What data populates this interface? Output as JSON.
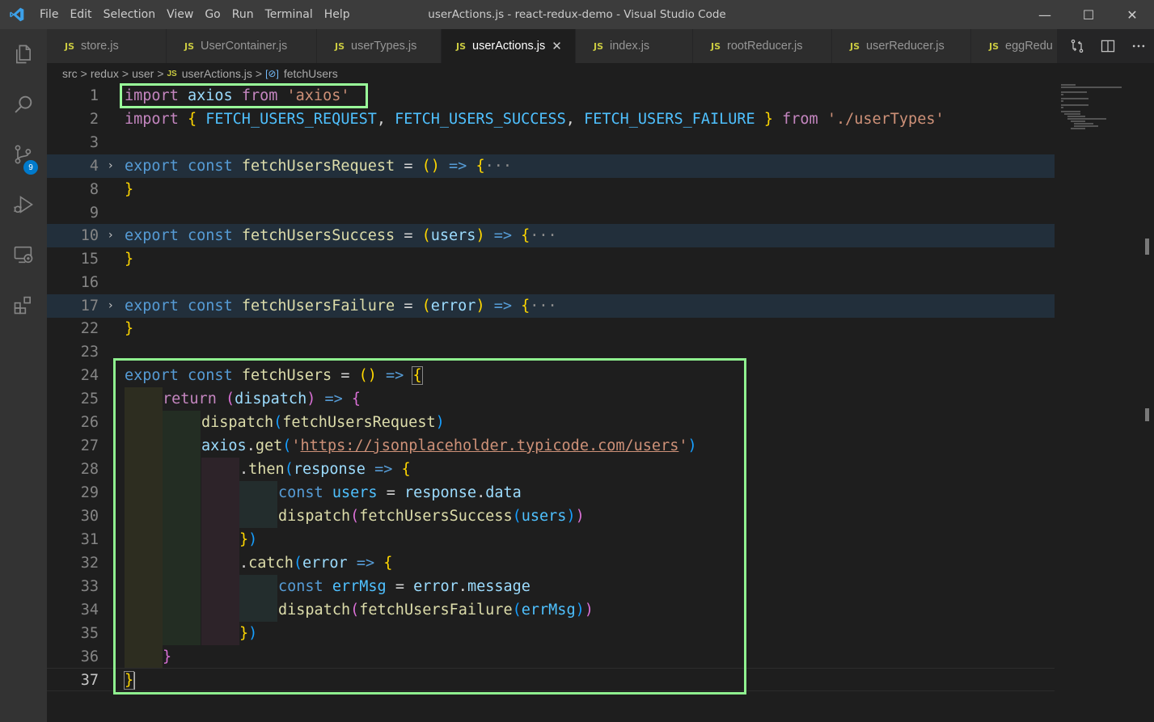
{
  "window": {
    "title": "userActions.js - react-redux-demo - Visual Studio Code",
    "menu": [
      "File",
      "Edit",
      "Selection",
      "View",
      "Go",
      "Run",
      "Terminal",
      "Help"
    ],
    "controls": {
      "minimize": "—",
      "maximize": "☐",
      "close": "✕"
    }
  },
  "activity_bar": {
    "items": [
      {
        "name": "explorer-icon"
      },
      {
        "name": "search-icon"
      },
      {
        "name": "source-control-icon",
        "badge": "9"
      },
      {
        "name": "run-debug-icon"
      },
      {
        "name": "remote-explorer-icon"
      },
      {
        "name": "extensions-icon"
      }
    ]
  },
  "tabs": [
    {
      "icon": "JS",
      "label": "store.js",
      "active": false
    },
    {
      "icon": "JS",
      "label": "UserContainer.js",
      "active": false
    },
    {
      "icon": "JS",
      "label": "userTypes.js",
      "active": false
    },
    {
      "icon": "JS",
      "label": "userActions.js",
      "active": true,
      "close": "✕"
    },
    {
      "icon": "JS",
      "label": "index.js",
      "active": false
    },
    {
      "icon": "JS",
      "label": "rootReducer.js",
      "active": false
    },
    {
      "icon": "JS",
      "label": "userReducer.js",
      "active": false
    },
    {
      "icon": "JS",
      "label": "eggRedu",
      "active": false
    }
  ],
  "tab_actions": [
    "compare-changes-icon",
    "split-editor-icon",
    "more-actions-icon"
  ],
  "breadcrumb": {
    "parts": [
      "src",
      "redux",
      "user",
      "userActions.js",
      "fetchUsers"
    ],
    "separator": ">",
    "file_icon": "JS",
    "symbol_icon": "[⊘]"
  },
  "editor": {
    "line_numbers": [
      "1",
      "2",
      "3",
      "4",
      "8",
      "9",
      "10",
      "15",
      "16",
      "17",
      "22",
      "23",
      "24",
      "25",
      "26",
      "27",
      "28",
      "29",
      "30",
      "31",
      "32",
      "33",
      "34",
      "35",
      "36",
      "37"
    ],
    "tokens": {
      "import": "import",
      "axios": "axios",
      "from": "from",
      "axios_str": "'axios'",
      "lbrace": "{",
      "rbrace": "}",
      "req": "FETCH_USERS_REQUEST",
      "succ": "FETCH_USERS_SUCCESS",
      "fail": "FETCH_USERS_FAILURE",
      "types_str": "'./userTypes'",
      "export": "export",
      "const": "const",
      "fetchUsersRequest": "fetchUsersRequest",
      "fetchUsersSuccess": "fetchUsersSuccess",
      "fetchUsersFailure": "fetchUsersFailure",
      "fetchUsers": "fetchUsers",
      "eq": "=",
      "arrow": "=>",
      "lparen": "(",
      "rparen": ")",
      "ellipsis": "···",
      "users": "users",
      "error": "error",
      "return": "return",
      "dispatch": "dispatch",
      "get": "get",
      "quote": "'",
      "url": "https://jsonplaceholder.typicode.com/users",
      "dot": ".",
      "then": "then",
      "catch": "catch",
      "response": "response",
      "data": "data",
      "errMsg": "errMsg",
      "message": "message",
      "comma": ",",
      "rbrace_paren": "})"
    }
  },
  "colors": {
    "highlight_box": "#9aff9a",
    "keyword": "#c586c0",
    "storage": "#569cd6",
    "function": "#dcdcaa",
    "variable": "#9cdcfe",
    "constant": "#4fc1ff",
    "string": "#ce9178"
  }
}
